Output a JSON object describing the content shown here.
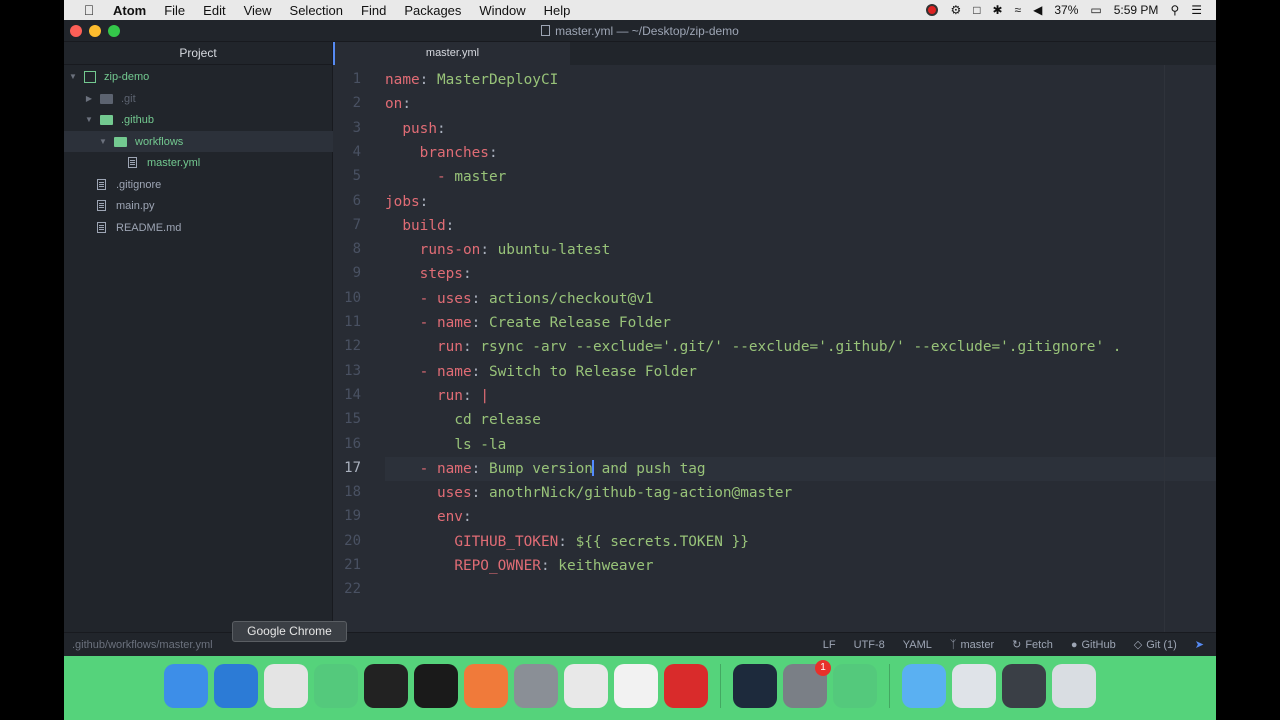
{
  "menubar": {
    "app_name": "Atom",
    "items": [
      "File",
      "Edit",
      "View",
      "Selection",
      "Find",
      "Packages",
      "Window",
      "Help"
    ],
    "battery": "37%",
    "time": "5:59 PM"
  },
  "window": {
    "title": "master.yml — ~/Desktop/zip-demo"
  },
  "tree": {
    "header": "Project",
    "root": "zip-demo",
    "items": [
      {
        "label": ".git"
      },
      {
        "label": ".github"
      },
      {
        "label": "workflows"
      },
      {
        "label": "master.yml"
      },
      {
        "label": ".gitignore"
      },
      {
        "label": "main.py"
      },
      {
        "label": "README.md"
      }
    ]
  },
  "tab": {
    "label": "master.yml"
  },
  "code": {
    "cursor_line": 17,
    "lines": [
      {
        "n": "1",
        "k": "name",
        "v": "MasterDeployCI",
        "indent": ""
      },
      {
        "n": "2",
        "k": "on",
        "v": "",
        "indent": ""
      },
      {
        "n": "3",
        "k": "push",
        "v": "",
        "indent": "  "
      },
      {
        "n": "4",
        "k": "branches",
        "v": "",
        "indent": "    "
      },
      {
        "n": "5",
        "k": "",
        "v": "- master",
        "indent": "      "
      },
      {
        "n": "6",
        "k": "jobs",
        "v": "",
        "indent": ""
      },
      {
        "n": "7",
        "k": "build",
        "v": "",
        "indent": "  "
      },
      {
        "n": "8",
        "k": "runs-on",
        "v": "ubuntu-latest",
        "indent": "    "
      },
      {
        "n": "9",
        "k": "steps",
        "v": "",
        "indent": "    "
      },
      {
        "n": "10",
        "k": "uses",
        "v": "actions/checkout@v1",
        "indent": "    ",
        "dash": true
      },
      {
        "n": "11",
        "k": "name",
        "v": "Create Release Folder",
        "indent": "    ",
        "dash": true
      },
      {
        "n": "12",
        "k": "run",
        "v": "rsync -arv --exclude='.git/' --exclude='.github/' --exclude='.gitignore' .",
        "indent": "      "
      },
      {
        "n": "13",
        "k": "name",
        "v": "Switch to Release Folder",
        "indent": "    ",
        "dash": true
      },
      {
        "n": "14",
        "k": "run",
        "v": "|",
        "indent": "      "
      },
      {
        "n": "15",
        "k": "",
        "v": "cd release",
        "indent": "        "
      },
      {
        "n": "16",
        "k": "",
        "v": "ls -la",
        "indent": "        "
      },
      {
        "n": "17",
        "k": "name",
        "v": "Bump version and push tag",
        "indent": "    ",
        "dash": true
      },
      {
        "n": "18",
        "k": "uses",
        "v": "anothrNick/github-tag-action@master",
        "indent": "      "
      },
      {
        "n": "19",
        "k": "env",
        "v": "",
        "indent": "      "
      },
      {
        "n": "20",
        "k": "GITHUB_TOKEN",
        "v": "${{ secrets.TOKEN }}",
        "indent": "        "
      },
      {
        "n": "21",
        "k": "REPO_OWNER",
        "v": "keithweaver",
        "indent": "        "
      },
      {
        "n": "22",
        "k": "",
        "v": "",
        "indent": ""
      }
    ]
  },
  "status": {
    "path": ".github/workflows/master.yml",
    "line_ending": "LF",
    "encoding": "UTF-8",
    "grammar": "YAML",
    "branch": "master",
    "fetch": "Fetch",
    "github": "GitHub",
    "git": "Git (1)"
  },
  "tooltip": {
    "text": "Google Chrome"
  },
  "dock": {
    "apps": [
      {
        "name": "finder-icon",
        "color": "#3d8ee8"
      },
      {
        "name": "safari-icon",
        "color": "#2c7bd6"
      },
      {
        "name": "chrome-icon",
        "color": "#e4e4e4"
      },
      {
        "name": "atom-icon",
        "color": "#54c97c"
      },
      {
        "name": "terminal-icon",
        "color": "#222222"
      },
      {
        "name": "intellij-icon",
        "color": "#1a1a1a"
      },
      {
        "name": "sketch-icon",
        "color": "#f07a3a"
      },
      {
        "name": "database-icon",
        "color": "#8a8f96"
      },
      {
        "name": "unity-icon",
        "color": "#e8e8e8"
      },
      {
        "name": "slack-icon",
        "color": "#f2f2f2"
      },
      {
        "name": "postman-icon",
        "color": "#d92b2b"
      },
      {
        "name": "quicktime-icon",
        "color": "#1d2a3c"
      },
      {
        "name": "system-prefs-icon",
        "color": "#7a7f86",
        "badge": "1"
      },
      {
        "name": "atom-icon-2",
        "color": "#54c97c"
      },
      {
        "name": "folder-icon",
        "color": "#5ab0f2"
      },
      {
        "name": "screenshot-icon",
        "color": "#dfe3e8"
      },
      {
        "name": "display-icon",
        "color": "#3a3f46"
      },
      {
        "name": "trash-icon",
        "color": "#d9dde2"
      }
    ]
  }
}
